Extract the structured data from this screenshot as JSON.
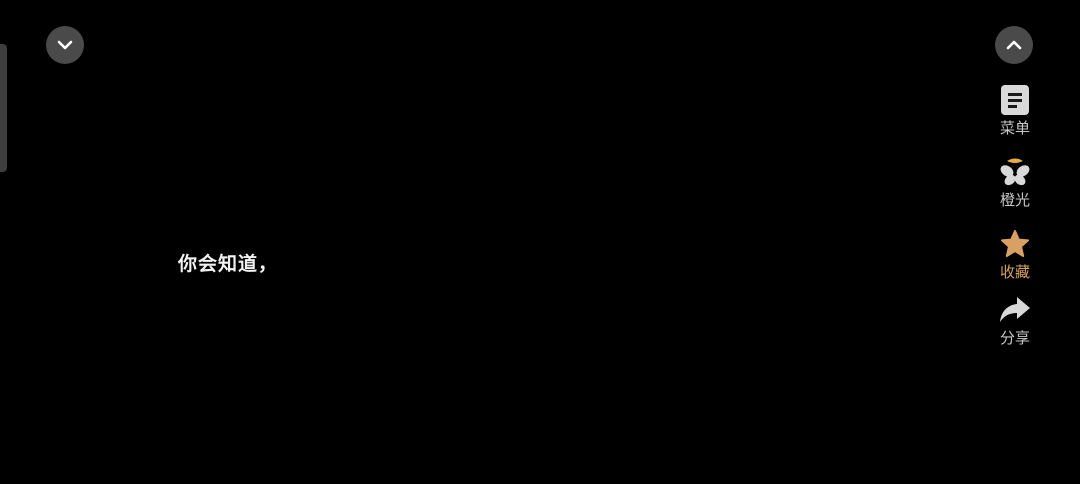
{
  "content": {
    "caption": "你会知道，"
  },
  "side_actions": [
    {
      "label": "菜单",
      "icon": "menu-icon"
    },
    {
      "label": "橙光",
      "icon": "orange-light-icon"
    },
    {
      "label": "收藏",
      "icon": "star-icon",
      "active": true
    },
    {
      "label": "分享",
      "icon": "share-icon"
    }
  ],
  "controls": {
    "collapse_icon": "chevron-down-icon",
    "expand_icon": "chevron-up-icon"
  },
  "colors": {
    "background": "#000000",
    "button_bg": "#4a4a4a",
    "favorite_accent": "#d9a064",
    "label_text": "#c8c8c8"
  }
}
